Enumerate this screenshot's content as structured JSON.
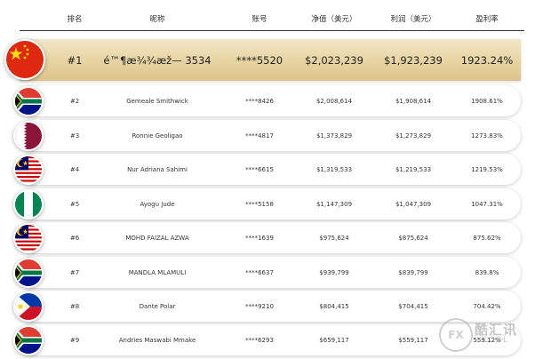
{
  "header": {
    "rank": "排名",
    "name": "昵称",
    "account": "账号",
    "net_value": "净值（美元）",
    "profit": "利润（美元）",
    "profit_rate": "盈利率"
  },
  "rows": [
    {
      "rank": "#1",
      "name": "é™¶æ¾¾æž— 3534",
      "account": "****5520",
      "net_value": "$2,023,239",
      "profit": "$1,923,239",
      "profit_rate": "1923.24%",
      "flag": "china-flag-icon"
    },
    {
      "rank": "#2",
      "name": "Gemeale Smithwick",
      "account": "****8426",
      "net_value": "$2,008,614",
      "profit": "$1,908,614",
      "profit_rate": "1908.61%",
      "flag": "south-africa-flag-icon"
    },
    {
      "rank": "#3",
      "name": "Ronnie Geoligao",
      "account": "****4817",
      "net_value": "$1,373,829",
      "profit": "$1,273,829",
      "profit_rate": "1273.83%",
      "flag": "qatar-flag-icon"
    },
    {
      "rank": "#4",
      "name": "Nur Adriana Sahimi",
      "account": "****6615",
      "net_value": "$1,319,533",
      "profit": "$1,219,533",
      "profit_rate": "1219.53%",
      "flag": "malaysia-flag-icon"
    },
    {
      "rank": "#5",
      "name": "Ayogu Jude",
      "account": "****5158",
      "net_value": "$1,147,309",
      "profit": "$1,047,309",
      "profit_rate": "1047.31%",
      "flag": "nigeria-flag-icon"
    },
    {
      "rank": "#6",
      "name": "MOHD FAIZAL AZWA",
      "account": "****1639",
      "net_value": "$975,624",
      "profit": "$875,624",
      "profit_rate": "875.62%",
      "flag": "malaysia-flag-icon"
    },
    {
      "rank": "#7",
      "name": "MANDLA MLAMULI",
      "account": "****6637",
      "net_value": "$939,799",
      "profit": "$839,799",
      "profit_rate": "839.8%",
      "flag": "south-africa-flag-icon"
    },
    {
      "rank": "#8",
      "name": "Dante Polar",
      "account": "****9210",
      "net_value": "$804,415",
      "profit": "$704,415",
      "profit_rate": "704.42%",
      "flag": "philippines-flag-icon"
    },
    {
      "rank": "#9",
      "name": "Andries Maswabi Mmake",
      "account": "****6293",
      "net_value": "$659,117",
      "profit": "$559,117",
      "profit_rate": "559.12%",
      "flag": "south-africa-flag-icon"
    }
  ],
  "watermark": {
    "badge": "FX",
    "text": "酷汇讯",
    "sub": "XCOOL"
  }
}
